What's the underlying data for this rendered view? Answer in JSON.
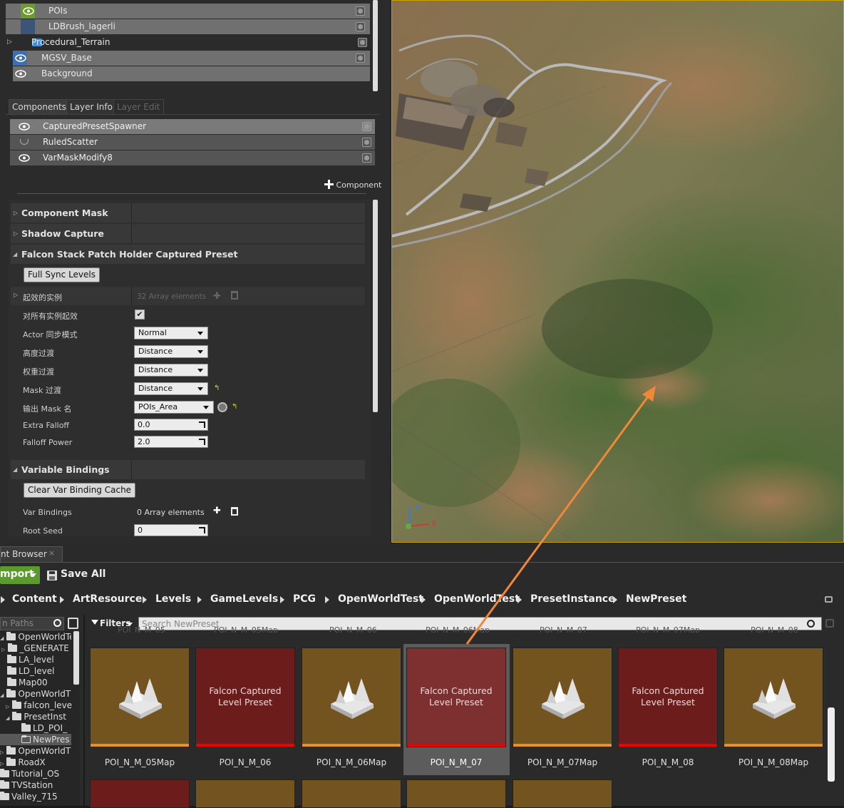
{
  "outliner": {
    "rows": [
      {
        "label": "POIs"
      },
      {
        "label": "LDBrush_lagerli"
      },
      {
        "label": "Procedural_Terrain"
      },
      {
        "label": "MGSV_Base"
      },
      {
        "label": "Background"
      }
    ]
  },
  "tabs": {
    "components": "Components",
    "layer_info": "Layer Info",
    "layer_edit": "Layer Edit"
  },
  "components": [
    {
      "label": "CapturedPresetSpawner"
    },
    {
      "label": "RuledScatter"
    },
    {
      "label": "VarMaskModify8"
    }
  ],
  "add_component": {
    "label": "Component"
  },
  "details": {
    "sections": {
      "component_mask": "Component Mask",
      "shadow_capture": "Shadow Capture",
      "falcon": "Falcon Stack Patch Holder Captured Preset",
      "variable_bindings": "Variable Bindings"
    },
    "full_sync_button": "Full Sync Levels",
    "props": {
      "active_instances": {
        "label": "起效的实例",
        "value": "32 Array elements"
      },
      "all_instances": {
        "label": "对所有实例起效",
        "checked": true
      },
      "actor_sync": {
        "label": "Actor 同步模式",
        "value": "Normal"
      },
      "height_fade": {
        "label": "高度过渡",
        "value": "Distance"
      },
      "weight_fade": {
        "label": "权重过渡",
        "value": "Distance"
      },
      "mask_fade": {
        "label": "Mask 过渡",
        "value": "Distance"
      },
      "output_mask": {
        "label": "输出 Mask 名",
        "value": "POIs_Area"
      },
      "extra_falloff": {
        "label": "Extra Falloff",
        "value": "0.0"
      },
      "falloff_power": {
        "label": "Falloff Power",
        "value": "2.0"
      }
    },
    "clear_cache_button": "Clear Var Binding Cache",
    "var_bindings": {
      "label": "Var Bindings",
      "value": "0 Array elements"
    },
    "root_seed": {
      "label": "Root Seed",
      "value": "0"
    }
  },
  "viewport": {
    "axis_x": "X",
    "axis_z": "Z"
  },
  "content_browser": {
    "tab_title": "nt Browser",
    "import_label": "mport",
    "save_all_label": "Save All",
    "breadcrumb": [
      "Content",
      "ArtResource",
      "Levels",
      "GameLevels",
      "PCG",
      "OpenWorldTest",
      "OpenWorldTest",
      "PresetInstance",
      "NewPreset"
    ],
    "paths_placeholder": "n Paths",
    "filters_label": "Filters",
    "search_placeholder": "Search NewPreset",
    "tree": [
      {
        "label": "OpenWorldTes"
      },
      {
        "label": "_GENERATE"
      },
      {
        "label": "LA_level"
      },
      {
        "label": "LD_level"
      },
      {
        "label": "Map00"
      },
      {
        "label": "OpenWorldT"
      },
      {
        "label": "falcon_leve"
      },
      {
        "label": "PresetInst"
      },
      {
        "label": "LD_POI_"
      },
      {
        "label": "NewPres"
      },
      {
        "label": "OpenWorldT"
      },
      {
        "label": "RoadX"
      },
      {
        "label": "Tutorial_OS"
      },
      {
        "label": "TVStation"
      },
      {
        "label": "Valley_715"
      }
    ],
    "faded_labels": [
      "POI_N_M_05",
      "POI_N_M_05Map",
      "POI_N_M_06",
      "POI_N_M_06Map",
      "POI_N_M_07",
      "POI_N_M_07Map",
      "POI_N_M_08"
    ],
    "assets": [
      {
        "name": "POI_N_M_05Map",
        "kind": "map"
      },
      {
        "name": "POI_N_M_06",
        "kind": "preset",
        "tile_text": "Falcon Captured Level Preset"
      },
      {
        "name": "POI_N_M_06Map",
        "kind": "map"
      },
      {
        "name": "POI_N_M_07",
        "kind": "preset",
        "tile_text": "Falcon Captured Level Preset"
      },
      {
        "name": "POI_N_M_07Map",
        "kind": "map"
      },
      {
        "name": "POI_N_M_08",
        "kind": "preset",
        "tile_text": "Falcon Captured Level Preset"
      },
      {
        "name": "POI_N_M_08Map",
        "kind": "map"
      }
    ]
  },
  "colors": {
    "annotation_arrow": "#f0883a",
    "viewport_border": "#caa200",
    "map_tile": "#73531e",
    "preset_tile": "#6d1c1c"
  }
}
